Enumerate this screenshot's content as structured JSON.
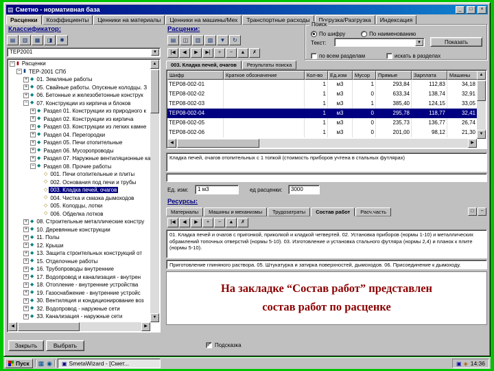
{
  "window": {
    "title": "Сметно - нормативная база",
    "controls": {
      "minimize": "_",
      "maximize": "□",
      "close": "×"
    },
    "nav_tabs": [
      "Расценки",
      "Коэффициенты",
      "Ценники на материалы",
      "Ценники на машины/Мех",
      "Транспортные расходы",
      "Погрузка/Разгрузка",
      "Индексация"
    ],
    "active_nav_tab": 0
  },
  "classifier": {
    "label": "Классификатор:",
    "combo_value": "ТЕР2001",
    "toolbar": [
      {
        "name": "levels",
        "glyph": "▤"
      },
      {
        "name": "expand-all",
        "glyph": "▥"
      },
      {
        "name": "collapse-all",
        "glyph": "▦"
      },
      {
        "name": "copy",
        "glyph": "◨"
      },
      {
        "name": "settings",
        "glyph": "✱"
      }
    ],
    "tree": [
      {
        "level": 0,
        "exp": "-",
        "icon": "bookr",
        "text": "Расценки"
      },
      {
        "level": 1,
        "exp": "-",
        "icon": "bookb",
        "text": "ТЕР-2001 СПб"
      },
      {
        "level": 2,
        "exp": "+",
        "icon": "chapter",
        "text": "01. Земляные работы"
      },
      {
        "level": 2,
        "exp": "+",
        "icon": "chapter",
        "text": "05. Свайные работы. Опускные колодцы. З"
      },
      {
        "level": 2,
        "exp": "+",
        "icon": "chapter",
        "text": "06. Бетонные и железобетонные конструк"
      },
      {
        "level": 2,
        "exp": "-",
        "icon": "chapter",
        "text": "07. Конструкции из кирпича и блоков"
      },
      {
        "level": 3,
        "exp": "+",
        "icon": "chapter",
        "text": "Раздел 01. Конструкции из природного к"
      },
      {
        "level": 3,
        "exp": "+",
        "icon": "chapter",
        "text": "Раздел 02. Конструкции из кирпича"
      },
      {
        "level": 3,
        "exp": "+",
        "icon": "chapter",
        "text": "Раздел 03. Конструкции из легких камне"
      },
      {
        "level": 3,
        "exp": "+",
        "icon": "chapter",
        "text": "Раздел 04. Перегородки"
      },
      {
        "level": 3,
        "exp": "+",
        "icon": "chapter",
        "text": "Раздел 05. Печи отопительные"
      },
      {
        "level": 3,
        "exp": "+",
        "icon": "chapter",
        "text": "Раздел 06. Мусоропроводы"
      },
      {
        "level": 3,
        "exp": "+",
        "icon": "chapter",
        "text": "Раздел 07. Наружные вентиляционные кан"
      },
      {
        "level": 3,
        "exp": "-",
        "icon": "chapter",
        "text": "Раздел 08. Прочие работы"
      },
      {
        "level": 4,
        "exp": "",
        "icon": "leaf",
        "text": "001. Печи отопительные и плиты"
      },
      {
        "level": 4,
        "exp": "",
        "icon": "leaf",
        "text": "002. Основания под печи и трубы"
      },
      {
        "level": 4,
        "exp": "",
        "icon": "leaf",
        "text": "003. Кладка печей, очагов",
        "selected": true
      },
      {
        "level": 4,
        "exp": "",
        "icon": "leaf",
        "text": "004. Чистка и смазка дымоходов"
      },
      {
        "level": 4,
        "exp": "",
        "icon": "leaf",
        "text": "005. Колодцы, лотки"
      },
      {
        "level": 4,
        "exp": "",
        "icon": "leaf",
        "text": "006. Обделка лотков"
      },
      {
        "level": 2,
        "exp": "+",
        "icon": "chapter",
        "text": "08. Строительные металлические констру"
      },
      {
        "level": 2,
        "exp": "+",
        "icon": "chapter",
        "text": "10. Деревянные конструкции"
      },
      {
        "level": 2,
        "exp": "+",
        "icon": "chapter",
        "text": "11. Полы"
      },
      {
        "level": 2,
        "exp": "+",
        "icon": "chapter",
        "text": "12. Крыши"
      },
      {
        "level": 2,
        "exp": "+",
        "icon": "chapter",
        "text": "13. Защита строительных конструкций от"
      },
      {
        "level": 2,
        "exp": "+",
        "icon": "chapter",
        "text": "15. Отделочные работы"
      },
      {
        "level": 2,
        "exp": "+",
        "icon": "chapter",
        "text": "16. Трубопроводы внутренние"
      },
      {
        "level": 2,
        "exp": "+",
        "icon": "chapter",
        "text": "17. Водопровод и канализация - внутрен"
      },
      {
        "level": 2,
        "exp": "+",
        "icon": "chapter",
        "text": "18. Отопление - внутренние устройства"
      },
      {
        "level": 2,
        "exp": "+",
        "icon": "chapter",
        "text": "19. Газоснабжение - внутренние устройс"
      },
      {
        "level": 2,
        "exp": "+",
        "icon": "chapter",
        "text": "30. Вентиляция и кондиционирование воз"
      },
      {
        "level": 2,
        "exp": "+",
        "icon": "chapter",
        "text": "32. Водопровод - наружные сети"
      },
      {
        "level": 2,
        "exp": "+",
        "icon": "chapter",
        "text": "33. Канализация - наружные сети"
      }
    ]
  },
  "rates": {
    "label": "Расценки:",
    "toolbar": [
      {
        "name": "print",
        "glyph": "▤"
      },
      {
        "name": "preview",
        "glyph": "◫"
      },
      {
        "name": "copy",
        "glyph": "▥"
      },
      {
        "name": "export",
        "glyph": "▧"
      },
      {
        "name": "filter",
        "glyph": "▼"
      },
      {
        "name": "refresh",
        "glyph": "↻"
      }
    ],
    "nav": [
      {
        "name": "first-record",
        "glyph": "|◀"
      },
      {
        "name": "prev-record",
        "glyph": "◀"
      },
      {
        "name": "next-record",
        "glyph": "▶"
      },
      {
        "name": "last-record",
        "glyph": "▶|"
      },
      {
        "name": "insert-record",
        "glyph": "+"
      },
      {
        "name": "delete-record",
        "glyph": "−"
      },
      {
        "name": "edit-record",
        "glyph": "▲"
      },
      {
        "name": "cancel-record",
        "glyph": "✗"
      }
    ],
    "search": {
      "group_label": "Поиск",
      "radio_by_code": {
        "label": "По шифру",
        "checked": true
      },
      "radio_by_name": {
        "label": "По наименованию",
        "checked": false
      },
      "text_label": "Текст:",
      "text_value": "",
      "show_button": "Показать",
      "checkbox_all_sections": {
        "label": "по всем разделам",
        "checked": false
      },
      "checkbox_in_sections": {
        "label": "искать в разделах",
        "checked": false
      }
    },
    "tabs": [
      "003. Кладка печей, очагов",
      "Результаты поиска"
    ],
    "active_tab": 0,
    "table": {
      "columns": [
        "Шифр",
        "Краткое обозначение",
        "Кол-во",
        "Ед.изм",
        "Мусор",
        "Прямые",
        "Зарплата",
        "Машины"
      ],
      "selected_index": 3,
      "rows": [
        [
          "ТЕР08-002-01",
          "",
          "1",
          "м3",
          "1",
          "293,84",
          "112,83",
          "34,18"
        ],
        [
          "ТЕР08-002-02",
          "",
          "1",
          "м3",
          "0",
          "633,34",
          "138,74",
          "32,91"
        ],
        [
          "ТЕР08-002-03",
          "",
          "1",
          "м3",
          "1",
          "385,40",
          "124,15",
          "33,05"
        ],
        [
          "ТЕР08-002-04",
          "",
          "1",
          "м3",
          "0",
          "295,78",
          "118,77",
          "32,41"
        ],
        [
          "ТЕР08-002-05",
          "",
          "1",
          "м3",
          "0",
          "235,73",
          "136,77",
          "26,74"
        ],
        [
          "ТЕР08-002-06",
          "",
          "1",
          "м3",
          "0",
          "201,00",
          "98,12",
          "21,30"
        ]
      ]
    },
    "description": "Кладка печей, очагов отопительных с 1 топкой (стоимость приборов учтена в стальных футлярах)",
    "unit": {
      "label": "Ед. изм:",
      "value": "1 м3",
      "per_label": "ед расценки:",
      "per_value": "3000"
    }
  },
  "resources": {
    "label": "Ресурсы:",
    "tabs": [
      "Материалы",
      "Машины и механизмы",
      "Трудозатраты",
      "Состав работ",
      "Расч.часть"
    ],
    "active_tab": 3,
    "panel_buttons": [
      {
        "name": "maximize-resources",
        "glyph": "□"
      },
      {
        "name": "collapse-resources",
        "glyph": "−"
      }
    ],
    "nav": [
      {
        "name": "first-record",
        "glyph": "|◀"
      },
      {
        "name": "prev-record",
        "glyph": "◀"
      },
      {
        "name": "next-record",
        "glyph": "▶"
      },
      {
        "name": "insert-record",
        "glyph": "+"
      },
      {
        "name": "delete-record",
        "glyph": "−"
      },
      {
        "name": "edit-record",
        "glyph": "▲"
      },
      {
        "name": "cancel-record",
        "glyph": "✗"
      }
    ],
    "composition_text_1": "01. Кладка печей и очагов с пригонкой, приколкой и кладкой четвертей. 02. Установка приборов (нормы 1-10) и металлических обрамлений топочных отверстий (нормы 5-10). 03. Изготовление и установка стального футляра (нормы 2,4) и планок к плите (нормы 5-10).",
    "composition_text_2": "Приготовление глиняного раствора. 05. Штукатурка и затирка поверхностей, дымоходов. 06. Присоединение к дымоходу.",
    "note_line1": "На закладке “Состав работ” представлен",
    "note_line2": "состав работ по расценке"
  },
  "footer": {
    "close_button": "Закрыть",
    "select_button": "Выбрать",
    "hint_checkbox": {
      "label": "Подсказка",
      "checked": true
    }
  },
  "taskbar": {
    "start_label": "Пуск",
    "quick_launch": [
      {
        "name": "show-desktop",
        "glyph": "▦"
      },
      {
        "name": "browser",
        "glyph": "◉"
      }
    ],
    "task_button": "SmetaWizard - [Смет...",
    "tray": [
      {
        "name": "tray-app-1",
        "glyph": "▣"
      },
      {
        "name": "tray-app-2",
        "glyph": "◈"
      }
    ],
    "time": "14:36"
  }
}
